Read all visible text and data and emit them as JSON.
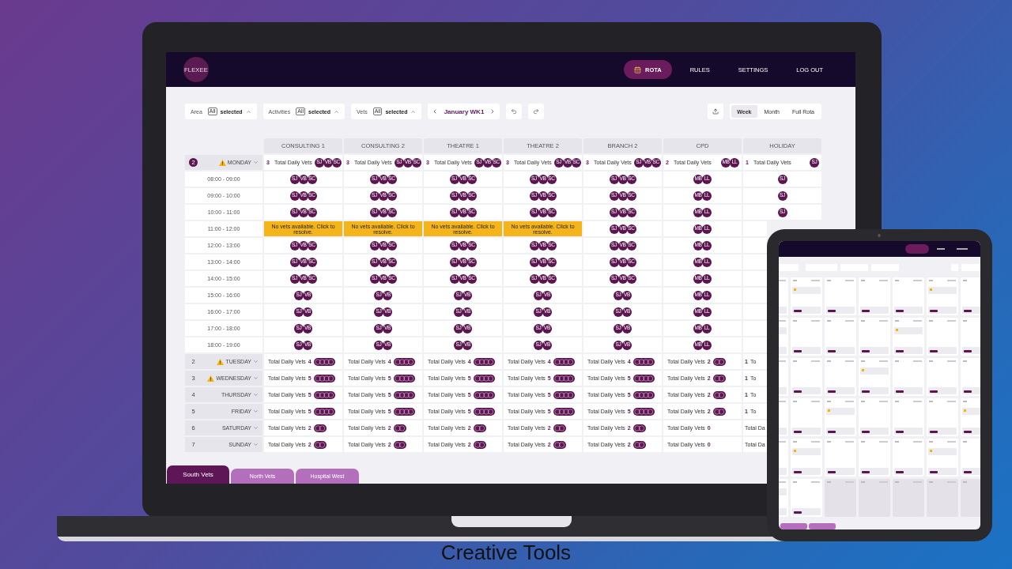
{
  "logo": {
    "text": "FLEXEE"
  },
  "nav": [
    {
      "label": "ROTA",
      "selected": true
    },
    {
      "label": "RULES",
      "selected": false
    },
    {
      "label": "SETTINGS",
      "selected": false
    },
    {
      "label": "LOG OUT",
      "selected": false
    }
  ],
  "filters": [
    {
      "label": "Area",
      "badge": "All",
      "value": "selected"
    },
    {
      "label": "Activities",
      "badge": "All",
      "value": "selected"
    },
    {
      "label": "Vets",
      "badge": "All",
      "value": "selected"
    }
  ],
  "period": "January WK1",
  "views": [
    {
      "label": "Week",
      "selected": true
    },
    {
      "label": "Month",
      "selected": false
    },
    {
      "label": "Full Rota",
      "selected": false
    }
  ],
  "columns": [
    "CONSULTING 1",
    "CONSULTING 2",
    "THEATRE 1",
    "THEATRE 2",
    "BRANCH 2",
    "CPD",
    "HOLIDAY"
  ],
  "monday": {
    "number": "2",
    "highlighted": true,
    "warning": true,
    "name": "MONDAY",
    "totals": [
      {
        "kind": "count_first",
        "count": "3",
        "label": "Total Daily Vets",
        "avatars": [
          "SJ",
          "VB",
          "SC"
        ]
      },
      {
        "kind": "count_first",
        "count": "3",
        "label": "Total Daily Vets",
        "avatars": [
          "SJ",
          "VB",
          "SC"
        ]
      },
      {
        "kind": "count_first",
        "count": "3",
        "label": "Total Daily Vets",
        "avatars": [
          "SJ",
          "VB",
          "SC"
        ]
      },
      {
        "kind": "count_first",
        "count": "3",
        "label": "Total Daily Vets",
        "avatars": [
          "SJ",
          "VB",
          "SC"
        ]
      },
      {
        "kind": "count_first",
        "count": "3",
        "label": "Total Daily Vets",
        "avatars": [
          "SJ",
          "VB",
          "SC"
        ]
      },
      {
        "kind": "count_first",
        "count": "2",
        "label": "Total Daily Vets",
        "avatars": [
          "MB",
          "LL"
        ]
      },
      {
        "kind": "count_first",
        "count": "1",
        "label": "Total Daily Vets",
        "avatars": [
          "SJ"
        ]
      }
    ],
    "slots": [
      {
        "time": "08:00 - 09:00",
        "cells": [
          {
            "kind": "avatars",
            "avatars": [
              "SJ",
              "VB",
              "SC"
            ]
          },
          {
            "kind": "avatars",
            "avatars": [
              "SJ",
              "VB",
              "SC"
            ]
          },
          {
            "kind": "avatars",
            "avatars": [
              "SJ",
              "VB",
              "SC"
            ]
          },
          {
            "kind": "avatars",
            "avatars": [
              "SJ",
              "VB",
              "SC"
            ]
          },
          {
            "kind": "avatars",
            "avatars": [
              "SJ",
              "VB",
              "SC"
            ]
          },
          {
            "kind": "avatars",
            "avatars": [
              "MB",
              "LL"
            ]
          },
          {
            "kind": "avatars",
            "avatars": [
              "SJ"
            ]
          }
        ]
      },
      {
        "time": "09:00 - 10:00",
        "cells": [
          {
            "kind": "avatars",
            "avatars": [
              "SJ",
              "VB",
              "SC"
            ]
          },
          {
            "kind": "avatars",
            "avatars": [
              "SJ",
              "VB",
              "SC"
            ]
          },
          {
            "kind": "avatars",
            "avatars": [
              "SJ",
              "VB",
              "SC"
            ]
          },
          {
            "kind": "avatars",
            "avatars": [
              "SJ",
              "VB",
              "SC"
            ]
          },
          {
            "kind": "avatars",
            "avatars": [
              "SJ",
              "VB",
              "SC"
            ]
          },
          {
            "kind": "avatars",
            "avatars": [
              "MB",
              "LL"
            ]
          },
          {
            "kind": "avatars",
            "avatars": [
              "SJ"
            ]
          }
        ]
      },
      {
        "time": "10:00 - 11:00",
        "cells": [
          {
            "kind": "avatars",
            "avatars": [
              "SJ",
              "VB",
              "SC"
            ]
          },
          {
            "kind": "avatars",
            "avatars": [
              "SJ",
              "VB",
              "SC"
            ]
          },
          {
            "kind": "avatars",
            "avatars": [
              "SJ",
              "VB",
              "SC"
            ]
          },
          {
            "kind": "avatars",
            "avatars": [
              "SJ",
              "VB",
              "SC"
            ]
          },
          {
            "kind": "avatars",
            "avatars": [
              "SJ",
              "VB",
              "SC"
            ]
          },
          {
            "kind": "avatars",
            "avatars": [
              "MB",
              "LL"
            ]
          },
          {
            "kind": "avatars",
            "avatars": [
              "SJ"
            ]
          }
        ]
      },
      {
        "time": "11:00 - 12:00",
        "cells": [
          {
            "kind": "alert",
            "text": "No vets available. Click to resolve."
          },
          {
            "kind": "alert",
            "text": "No vets available. Click to resolve."
          },
          {
            "kind": "alert",
            "text": "No vets available. Click to resolve."
          },
          {
            "kind": "alert",
            "text": "No vets available. Click to resolve."
          },
          {
            "kind": "avatars",
            "avatars": [
              "SJ",
              "VB",
              "SC"
            ]
          },
          {
            "kind": "avatars",
            "avatars": [
              "MB",
              "LL"
            ]
          },
          {
            "kind": "blank"
          }
        ]
      },
      {
        "time": "12:00 - 13:00",
        "cells": [
          {
            "kind": "avatars",
            "avatars": [
              "SJ",
              "VB",
              "SC"
            ]
          },
          {
            "kind": "avatars",
            "avatars": [
              "SJ",
              "VB",
              "SC"
            ]
          },
          {
            "kind": "avatars",
            "avatars": [
              "SJ",
              "VB",
              "SC"
            ]
          },
          {
            "kind": "avatars",
            "avatars": [
              "SJ",
              "VB",
              "SC"
            ]
          },
          {
            "kind": "avatars",
            "avatars": [
              "SJ",
              "VB",
              "SC"
            ]
          },
          {
            "kind": "avatars",
            "avatars": [
              "MB",
              "LL"
            ]
          },
          {
            "kind": "blank"
          }
        ]
      },
      {
        "time": "13:00 - 14:00",
        "cells": [
          {
            "kind": "avatars",
            "avatars": [
              "SJ",
              "VB",
              "SC"
            ]
          },
          {
            "kind": "avatars",
            "avatars": [
              "SJ",
              "VB",
              "SC"
            ]
          },
          {
            "kind": "avatars",
            "avatars": [
              "SJ",
              "VB",
              "SC"
            ]
          },
          {
            "kind": "avatars",
            "avatars": [
              "SJ",
              "VB",
              "SC"
            ]
          },
          {
            "kind": "avatars",
            "avatars": [
              "SJ",
              "VB",
              "SC"
            ]
          },
          {
            "kind": "avatars",
            "avatars": [
              "MB",
              "LL"
            ]
          },
          {
            "kind": "blank"
          }
        ]
      },
      {
        "time": "14:00 - 15:00",
        "cells": [
          {
            "kind": "avatars",
            "avatars": [
              "SJ",
              "VB",
              "SC"
            ]
          },
          {
            "kind": "avatars",
            "avatars": [
              "SJ",
              "VB",
              "SC"
            ]
          },
          {
            "kind": "avatars",
            "avatars": [
              "SJ",
              "VB",
              "SC"
            ]
          },
          {
            "kind": "avatars",
            "avatars": [
              "SJ",
              "VB",
              "SC"
            ]
          },
          {
            "kind": "avatars",
            "avatars": [
              "SJ",
              "VB",
              "SC"
            ]
          },
          {
            "kind": "avatars",
            "avatars": [
              "MB",
              "LL"
            ]
          },
          {
            "kind": "blank"
          }
        ]
      },
      {
        "time": "15:00 - 16:00",
        "cells": [
          {
            "kind": "avatars",
            "avatars": [
              "SJ",
              "VB"
            ]
          },
          {
            "kind": "avatars",
            "avatars": [
              "SJ",
              "VB"
            ]
          },
          {
            "kind": "avatars",
            "avatars": [
              "SJ",
              "VB"
            ]
          },
          {
            "kind": "avatars",
            "avatars": [
              "SJ",
              "VB"
            ]
          },
          {
            "kind": "avatars",
            "avatars": [
              "SJ",
              "VB"
            ]
          },
          {
            "kind": "avatars",
            "avatars": [
              "MB",
              "LL"
            ]
          },
          {
            "kind": "blank"
          }
        ]
      },
      {
        "time": "16:00 - 17:00",
        "cells": [
          {
            "kind": "avatars",
            "avatars": [
              "SJ",
              "VB"
            ]
          },
          {
            "kind": "avatars",
            "avatars": [
              "SJ",
              "VB"
            ]
          },
          {
            "kind": "avatars",
            "avatars": [
              "SJ",
              "VB"
            ]
          },
          {
            "kind": "avatars",
            "avatars": [
              "SJ",
              "VB"
            ]
          },
          {
            "kind": "avatars",
            "avatars": [
              "SJ",
              "VB"
            ]
          },
          {
            "kind": "avatars",
            "avatars": [
              "MB",
              "LL"
            ]
          },
          {
            "kind": "blank"
          }
        ]
      },
      {
        "time": "17:00 - 18:00",
        "cells": [
          {
            "kind": "avatars",
            "avatars": [
              "SJ",
              "VB"
            ]
          },
          {
            "kind": "avatars",
            "avatars": [
              "SJ",
              "VB"
            ]
          },
          {
            "kind": "avatars",
            "avatars": [
              "SJ",
              "VB"
            ]
          },
          {
            "kind": "avatars",
            "avatars": [
              "SJ",
              "VB"
            ]
          },
          {
            "kind": "avatars",
            "avatars": [
              "SJ",
              "VB"
            ]
          },
          {
            "kind": "avatars",
            "avatars": [
              "MB",
              "LL"
            ]
          },
          {
            "kind": "blank"
          }
        ]
      },
      {
        "time": "18:00 - 19:00",
        "cells": [
          {
            "kind": "avatars",
            "avatars": [
              "SJ",
              "VB"
            ]
          },
          {
            "kind": "avatars",
            "avatars": [
              "SJ",
              "VB"
            ]
          },
          {
            "kind": "avatars",
            "avatars": [
              "SJ",
              "VB"
            ]
          },
          {
            "kind": "avatars",
            "avatars": [
              "SJ",
              "VB"
            ]
          },
          {
            "kind": "avatars",
            "avatars": [
              "SJ",
              "VB"
            ]
          },
          {
            "kind": "avatars",
            "avatars": [
              "MB",
              "LL"
            ]
          },
          {
            "kind": "blank"
          }
        ]
      }
    ]
  },
  "days": [
    {
      "number": "2",
      "highlighted": false,
      "warning": true,
      "name": "TUESDAY",
      "totals": [
        {
          "kind": "label_first",
          "label": "Total Daily Vets",
          "count": "4",
          "stacked": true
        },
        {
          "kind": "label_first",
          "label": "Total Daily Vets",
          "count": "4",
          "stacked": true
        },
        {
          "kind": "label_first",
          "label": "Total Daily Vets",
          "count": "4",
          "stacked": true
        },
        {
          "kind": "label_first",
          "label": "Total Daily Vets",
          "count": "4",
          "stacked": true
        },
        {
          "kind": "label_first",
          "label": "Total Daily Vets",
          "count": "4",
          "stacked": true
        },
        {
          "kind": "label_first",
          "label": "Total Daily Vets",
          "count": "2",
          "stacked": true
        },
        {
          "kind": "count_first",
          "count": "1",
          "label": "To"
        }
      ]
    },
    {
      "number": "3",
      "highlighted": false,
      "warning": true,
      "name": "WEDNESDAY",
      "totals": [
        {
          "kind": "label_first",
          "label": "Total Daily Vets",
          "count": "5",
          "stacked": true
        },
        {
          "kind": "label_first",
          "label": "Total Daily Vets",
          "count": "5",
          "stacked": true
        },
        {
          "kind": "label_first",
          "label": "Total Daily Vets",
          "count": "5",
          "stacked": true
        },
        {
          "kind": "label_first",
          "label": "Total Daily Vets",
          "count": "5",
          "stacked": true
        },
        {
          "kind": "label_first",
          "label": "Total Daily Vets",
          "count": "5",
          "stacked": true
        },
        {
          "kind": "label_first",
          "label": "Total Daily Vets",
          "count": "2",
          "stacked": true
        },
        {
          "kind": "count_first",
          "count": "1",
          "label": "To"
        }
      ]
    },
    {
      "number": "4",
      "highlighted": false,
      "warning": false,
      "name": "THURSDAY",
      "totals": [
        {
          "kind": "label_first",
          "label": "Total Daily Vets",
          "count": "5",
          "stacked": true
        },
        {
          "kind": "label_first",
          "label": "Total Daily Vets",
          "count": "5",
          "stacked": true
        },
        {
          "kind": "label_first",
          "label": "Total Daily Vets",
          "count": "5",
          "stacked": true
        },
        {
          "kind": "label_first",
          "label": "Total Daily Vets",
          "count": "5",
          "stacked": true
        },
        {
          "kind": "label_first",
          "label": "Total Daily Vets",
          "count": "5",
          "stacked": true
        },
        {
          "kind": "label_first",
          "label": "Total Daily Vets",
          "count": "2",
          "stacked": true
        },
        {
          "kind": "count_first",
          "count": "1",
          "label": "To"
        }
      ]
    },
    {
      "number": "5",
      "highlighted": false,
      "warning": false,
      "name": "FRIDAY",
      "totals": [
        {
          "kind": "label_first",
          "label": "Total Daily Vets",
          "count": "5",
          "stacked": true
        },
        {
          "kind": "label_first",
          "label": "Total Daily Vets",
          "count": "5",
          "stacked": true
        },
        {
          "kind": "label_first",
          "label": "Total Daily Vets",
          "count": "5",
          "stacked": true
        },
        {
          "kind": "label_first",
          "label": "Total Daily Vets",
          "count": "5",
          "stacked": true
        },
        {
          "kind": "label_first",
          "label": "Total Daily Vets",
          "count": "5",
          "stacked": true
        },
        {
          "kind": "label_first",
          "label": "Total Daily Vets",
          "count": "2",
          "stacked": true
        },
        {
          "kind": "count_first",
          "count": "1",
          "label": "To"
        }
      ]
    },
    {
      "number": "6",
      "highlighted": false,
      "warning": false,
      "name": "SATURDAY",
      "totals": [
        {
          "kind": "label_first",
          "label": "Total Daily Vets",
          "count": "2",
          "stacked": true
        },
        {
          "kind": "label_first",
          "label": "Total Daily Vets",
          "count": "2",
          "stacked": true
        },
        {
          "kind": "label_first",
          "label": "Total Daily Vets",
          "count": "2",
          "stacked": true
        },
        {
          "kind": "label_first",
          "label": "Total Daily Vets",
          "count": "2",
          "stacked": true
        },
        {
          "kind": "label_first",
          "label": "Total Daily Vets",
          "count": "2",
          "stacked": true
        },
        {
          "kind": "label_first",
          "label": "Total Daily Vets",
          "count": "0",
          "stacked": false
        },
        {
          "kind": "count_first",
          "label": "Total Da"
        }
      ]
    },
    {
      "number": "7",
      "highlighted": false,
      "warning": false,
      "name": "SUNDAY",
      "totals": [
        {
          "kind": "label_first",
          "label": "Total Daily Vets",
          "count": "2",
          "stacked": true
        },
        {
          "kind": "label_first",
          "label": "Total Daily Vets",
          "count": "2",
          "stacked": true
        },
        {
          "kind": "label_first",
          "label": "Total Daily Vets",
          "count": "2",
          "stacked": true
        },
        {
          "kind": "label_first",
          "label": "Total Daily Vets",
          "count": "2",
          "stacked": true
        },
        {
          "kind": "label_first",
          "label": "Total Daily Vets",
          "count": "2",
          "stacked": true
        },
        {
          "kind": "label_first",
          "label": "Total Daily Vets",
          "count": "0",
          "stacked": false
        },
        {
          "kind": "count_first",
          "label": "Total Da"
        }
      ]
    }
  ],
  "site_tabs": [
    {
      "label": "South Vets",
      "selected": true
    },
    {
      "label": "North Vets",
      "selected": false
    },
    {
      "label": "Hospital West",
      "selected": false
    }
  ],
  "caption": "Creative Tools"
}
